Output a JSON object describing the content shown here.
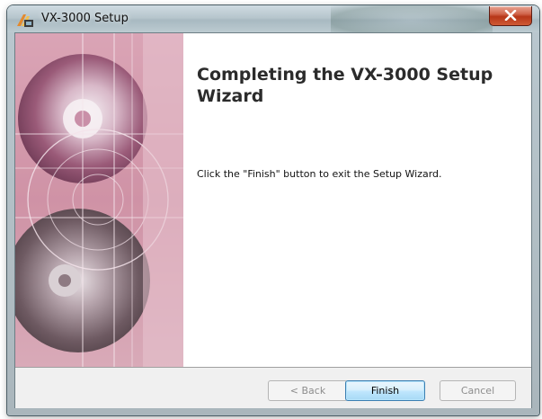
{
  "window": {
    "title": "VX-3000 Setup",
    "icon": "setup-app-icon",
    "close_icon": "close-icon"
  },
  "wizard": {
    "heading": "Completing the VX-3000 Setup Wizard",
    "body": "Click the \"Finish\" button to exit the Setup Wizard.",
    "banner_image": "cd-disc-banner-image"
  },
  "buttons": {
    "back_label": "< Back",
    "finish_label": "Finish",
    "cancel_label": "Cancel"
  },
  "colors": {
    "banner_pink": "#c97f98",
    "close_red": "#c84a2c",
    "focus_blue": "#3c7fb1"
  }
}
